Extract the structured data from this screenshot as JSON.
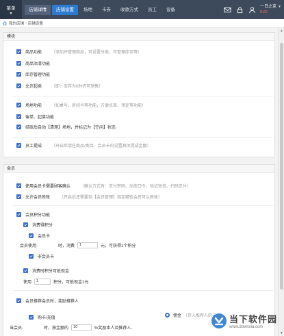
{
  "topbar": {
    "menu_label": "菜单",
    "nav": [
      {
        "label": "店铺详情",
        "state": "boxed"
      },
      {
        "label": "店铺设置",
        "state": "active"
      },
      {
        "label": "场地",
        "state": ""
      },
      {
        "label": "卡券",
        "state": ""
      },
      {
        "label": "收款方式",
        "state": ""
      },
      {
        "label": "员工",
        "state": ""
      },
      {
        "label": "设备",
        "state": ""
      }
    ],
    "user_name": "一日之克",
    "balance": "0.00"
  },
  "breadcrumb": {
    "home": "我的店铺",
    "sep": "›",
    "current": "店铺设置"
  },
  "module": {
    "title": "模块",
    "items": [
      {
        "label": "商品功能",
        "hint": "（添加并管理商品，可设置分类，可管理库存等）"
      },
      {
        "label": "商品沽清功能",
        "hint": ""
      },
      {
        "label": "库存管理功能",
        "hint": ""
      },
      {
        "label": "允许超卖",
        "hint": "（即：库存为0时仍可销售）"
      },
      {
        "label": "场地功能",
        "hint": "（如桌号、房间号等功能，方便点单、预定等功能）"
      },
      {
        "label": "催单、起菜功能",
        "hint": ""
      },
      {
        "label": "结账后自动【清理】场地，并标记为【空闲】状态",
        "hint": ""
      },
      {
        "label": "员工提成",
        "hint": "（开启后请在商品/类目、会员卡内设置具体提成金额）"
      }
    ]
  },
  "member": {
    "title": "会员",
    "confirm_label": "使用会员卡需要顾客确认",
    "confirm_hint": "（确认方式有：支付密码、动态口令、验证短信、扫码支付）",
    "allow_label": "允许会员赊账",
    "allow_hint": "（开启后还需要到【会员管理】指定哪些会员可以赊账）",
    "points_label": "会员积分功能",
    "earn_label": "消费得积分",
    "card_label": "会员卡",
    "use_prefix": "会员使用-",
    "use_mid": "时，消费",
    "use_value": "1",
    "use_suffix": "元，可获得1个积分",
    "noncard_label": "非会员卡",
    "redeem_label": "消费时积分可抵现金",
    "redeem_prefix": "使用",
    "redeem_value": "1",
    "redeem_suffix": "积分，可抵现金1元",
    "referral_label": "会员推荐会员时，奖励推荐人",
    "buycard_label": "购卡/充值",
    "commission_label": "佣金",
    "commission_hint": "（存入推荐人的卡…",
    "ref_prefix": "当会员-",
    "ref_mid": "时，按金额的",
    "ref_value": "10",
    "ref_suffix": "%奖励本人及推荐人-"
  },
  "watermark": {
    "cn": "当下软件园",
    "en": "www.downxia.com"
  }
}
